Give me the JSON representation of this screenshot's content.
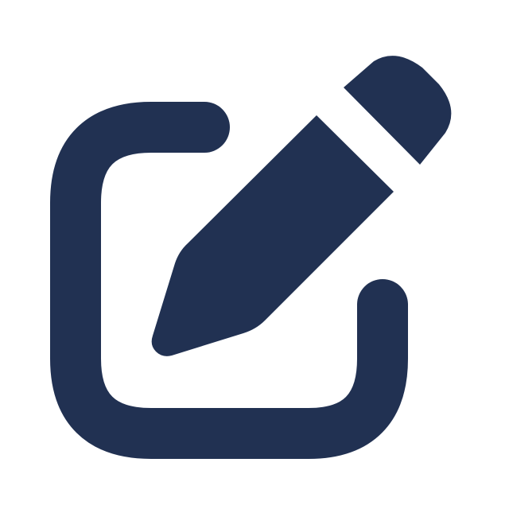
{
  "icon": {
    "name": "edit-icon",
    "color": "#213152",
    "background": "#ffffff"
  }
}
